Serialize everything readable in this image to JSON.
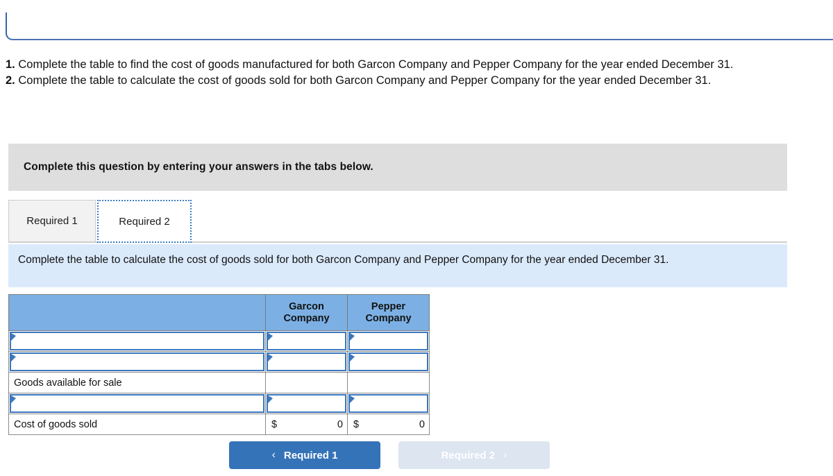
{
  "requirements": [
    {
      "num": "1.",
      "text": "Complete the table to find the cost of goods manufactured for both Garcon Company and Pepper Company for the year ended December 31."
    },
    {
      "num": "2.",
      "text": "Complete the table to calculate the cost of goods sold for both Garcon Company and Pepper Company for the year ended December 31."
    }
  ],
  "banner": {
    "text": "Complete this question by entering your answers in the tabs below."
  },
  "tabs": [
    {
      "label": "Required 1",
      "active": false
    },
    {
      "label": "Required 2",
      "active": true
    }
  ],
  "info": {
    "text": "Complete the table to calculate the cost of goods sold for both Garcon Company and Pepper Company for the year ended December 31."
  },
  "table": {
    "headers": [
      "",
      "Garcon Company",
      "Pepper Company"
    ],
    "rows": [
      {
        "type": "input",
        "label": "",
        "garcon": "",
        "pepper": ""
      },
      {
        "type": "input",
        "label": "",
        "garcon": "",
        "pepper": ""
      },
      {
        "type": "static",
        "label": "Goods available for sale",
        "garcon": "",
        "pepper": ""
      },
      {
        "type": "input",
        "label": "",
        "garcon": "",
        "pepper": ""
      },
      {
        "type": "total",
        "label": "Cost of goods sold",
        "garcon_currency": "$",
        "garcon": "0",
        "pepper_currency": "$",
        "pepper": "0"
      }
    ]
  },
  "nav": {
    "prev": {
      "label": "Required 1",
      "chevron": "‹"
    },
    "next": {
      "label": "Required 2",
      "chevron": "›"
    }
  }
}
